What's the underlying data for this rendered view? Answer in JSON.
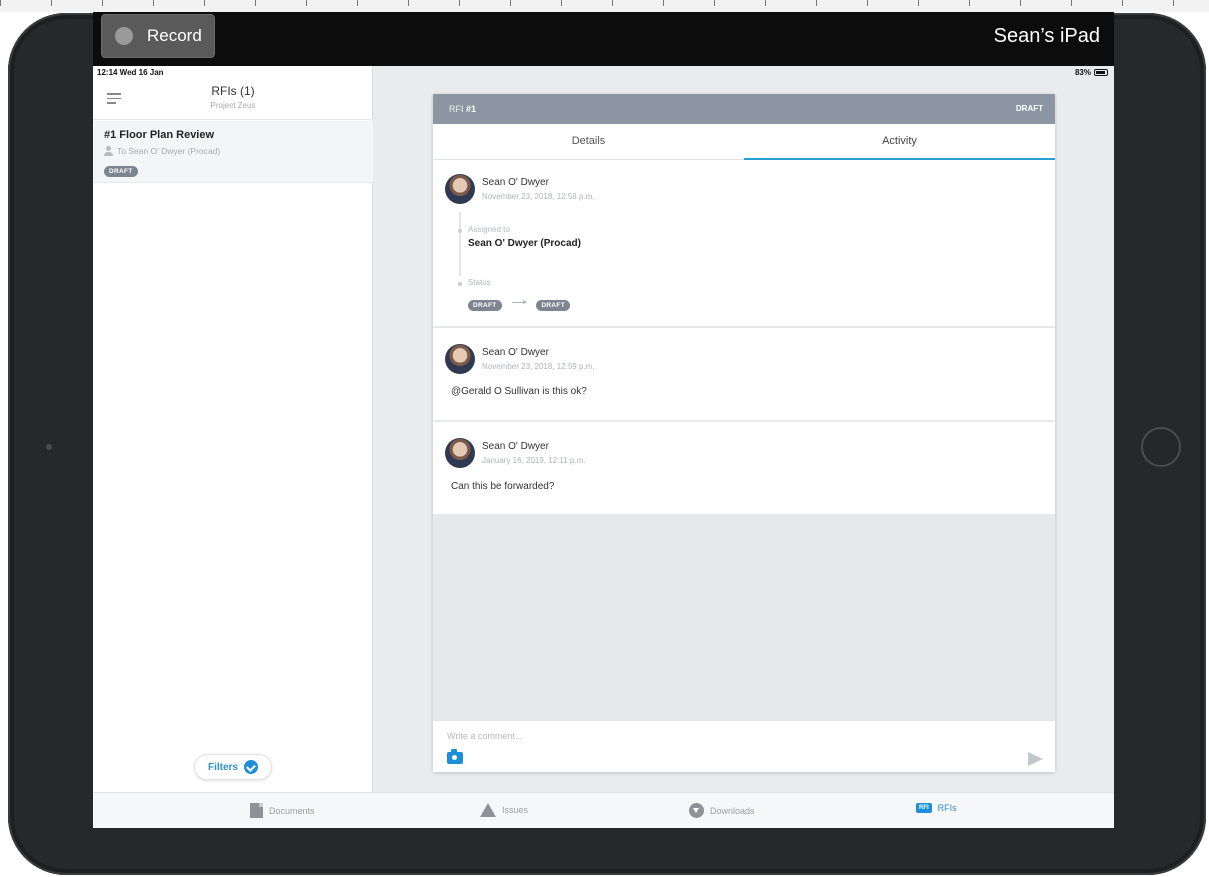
{
  "recorder": {
    "record_label": "Record",
    "device_name": "Sean’s iPad"
  },
  "status_bar": {
    "time": "12:14  Wed 16 Jan",
    "battery": "83%"
  },
  "sidebar": {
    "title": "RFIs (1)",
    "subtitle": "Project Zeus",
    "items": [
      {
        "title": "#1 Floor Plan Review",
        "assignee": "To Sean O' Dwyer (Procad)",
        "badge": "DRAFT"
      }
    ],
    "filters_label": "Filters"
  },
  "detail": {
    "header_prefix": "RFI",
    "header_id": "#1",
    "header_status": "DRAFT",
    "tabs": [
      {
        "label": "Details",
        "active": false
      },
      {
        "label": "Activity",
        "active": true
      }
    ],
    "activity": [
      {
        "author": "Sean O' Dwyer",
        "date": "November 23, 2018, 12:58 p.m.",
        "assigned_label": "Assigned to",
        "assigned_value": "Sean O' Dwyer (Procad)",
        "status_label": "Status",
        "status_from": "DRAFT",
        "status_to": "DRAFT"
      },
      {
        "author": "Sean O' Dwyer",
        "date": "November 23, 2018, 12:59 p.m.",
        "text": "@Gerald O Sullivan  is this ok?"
      },
      {
        "author": "Sean O' Dwyer",
        "date": "January 16, 2019, 12:11 p.m.",
        "text": "Can this be forwarded?"
      }
    ],
    "comment_placeholder": "Write a comment..."
  },
  "tabbar": {
    "items": [
      {
        "label": "Documents",
        "icon": "document-icon",
        "active": false
      },
      {
        "label": "Issues",
        "icon": "warning-icon",
        "active": false
      },
      {
        "label": "Downloads",
        "icon": "download-icon",
        "active": false
      },
      {
        "label": "RFIs",
        "icon": "rfi-icon",
        "icon_text": "RFI",
        "active": true
      }
    ]
  },
  "colors": {
    "accent": "#1d8fd8",
    "header_bar": "#8c96a3",
    "badge": "#7d8590"
  }
}
